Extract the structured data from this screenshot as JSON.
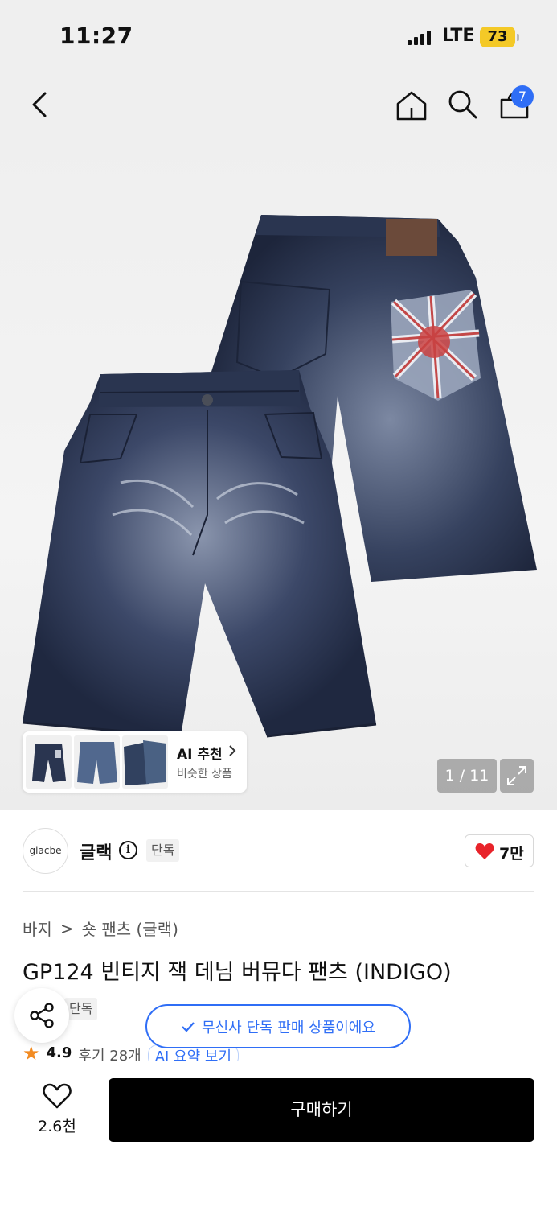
{
  "status": {
    "time": "11:27",
    "network": "LTE",
    "battery": "73"
  },
  "nav": {
    "cart_count": "7"
  },
  "gallery": {
    "ai_title": "AI 추천",
    "ai_subtitle": "비슷한 상품",
    "pager": "1 / 11"
  },
  "brand": {
    "logo_text": "glacbe",
    "name": "글랙",
    "exclusive_tag": "단독",
    "likes": "7만"
  },
  "product": {
    "breadcrumb": [
      "바지",
      ">",
      "숏 팬츠 (글랙)"
    ],
    "title": "GP124 빈티지 잭 데님 버뮤다 팬츠 (INDIGO)",
    "exclusive_tag": "단독",
    "rating": "4.9",
    "reviews": "후기 28개",
    "ai_summary": "AI 요약 보기"
  },
  "toast": {
    "message": "무신사 단독 판매 상품이에요"
  },
  "bottom": {
    "wish_count": "2.6천",
    "buy_label": "구매하기"
  },
  "colors": {
    "accent": "#2f6ef6",
    "heart": "#e8232a",
    "denim": "#2a3550"
  }
}
